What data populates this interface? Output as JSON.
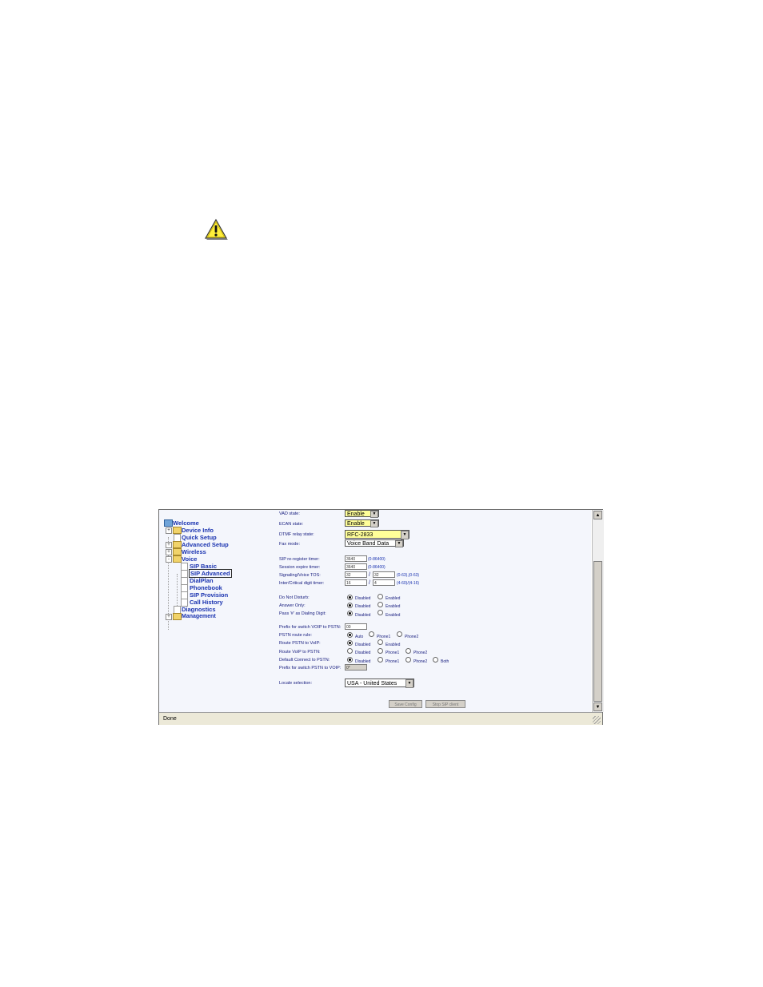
{
  "tree": {
    "root": "Welcome",
    "items": [
      {
        "label": "Device Info"
      },
      {
        "label": "Quick Setup"
      },
      {
        "label": "Advanced Setup"
      },
      {
        "label": "Wireless"
      },
      {
        "label": "Voice"
      },
      {
        "label": "SIP Basic"
      },
      {
        "label": "SIP Advanced"
      },
      {
        "label": "DialPlan"
      },
      {
        "label": "Phonebook"
      },
      {
        "label": "SIP Provision"
      },
      {
        "label": "Call History"
      },
      {
        "label": "Diagnostics"
      },
      {
        "label": "Management"
      }
    ],
    "expand_plus": "+",
    "expand_minus": "-"
  },
  "form": {
    "vad_label": "VAD state:",
    "vad_value": "Enable",
    "ecan_label": "ECAN state:",
    "ecan_value": "Enable",
    "dtmf_label": "DTMF relay state:",
    "dtmf_value": "RFC-2833",
    "fax_label": "Fax mode:",
    "fax_value": "Voice Band Data",
    "sip_rereg_label": "SIP re-register timer:",
    "sip_rereg_value": "3640",
    "sip_rereg_hint": "(0-86400)",
    "session_label": "Session expire timer:",
    "session_value": "3640",
    "session_hint": "(0-86400)",
    "tos_label": "Signaling/Voice TOS:",
    "tos_value1": "32",
    "tos_value2": "32",
    "tos_hint": "(0-63),(0-63)",
    "digit_label": "Inter/Critical digit timer:",
    "digit_value1": "16",
    "digit_value2": "4",
    "digit_hint": "(4-60)/(4-16)",
    "slash": "/",
    "dnd_label": "Do Not Disturb:",
    "answer_label": "Answer Only:",
    "pass_label": "Pass '#' as Dialing Digit:",
    "disabled": "Disabled",
    "enabled": "Enabled",
    "prefix_voip_label": "Prefix for switch VOIP to PSTN:",
    "prefix_voip_value": "00",
    "pstn_rule_label": "PSTN route rule:",
    "auto": "Auto",
    "phone1": "Phone1",
    "phone2": "Phone2",
    "both": "Both",
    "route_pstn_voip_label": "Route PSTN to VoIP:",
    "route_voip_pstn_label": "Route VoIP to PSTN:",
    "default_connect_label": "Default Connect to PSTN:",
    "prefix_pstn_label": "Prefix for switch PSTN to VOIP:",
    "prefix_pstn_value": "0*",
    "locale_label": "Locale selection:",
    "locale_value": "USA - United States",
    "save_button": "Save Config",
    "stop_button": "Stop SIP client"
  },
  "scrollbar": {
    "up": "▲",
    "down": "▼"
  },
  "dropdown_arrow": "▼",
  "status": {
    "text": "Done"
  }
}
